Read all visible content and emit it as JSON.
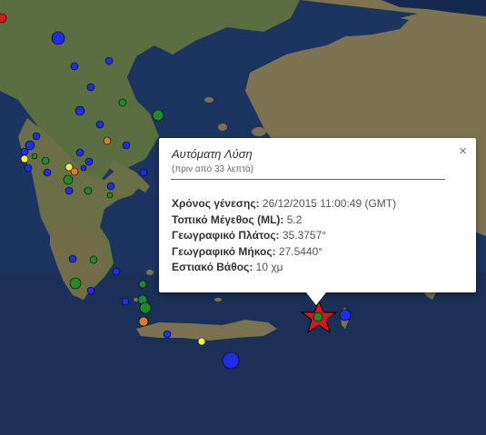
{
  "popup": {
    "title": "Αυτόματη Λύση",
    "subtitle": "(πριν από 33 λεπτά)",
    "close": "×",
    "rows": [
      {
        "label": "Χρόνος γένεσης:",
        "value": " 26/12/2015  11:00:49 (GMT)"
      },
      {
        "label": "Τοπικό Μέγεθος (ML):",
        "value": " 5.2"
      },
      {
        "label": "Γεωγραφικό Πλάτος:",
        "value": " 35.3757°"
      },
      {
        "label": "Γεωγραφικό Μήκος:",
        "value": " 27.5440°"
      },
      {
        "label": "Εστιακό Βάθος:",
        "value": " 10 χμ"
      }
    ]
  },
  "map": {
    "colors": {
      "sea_dark": "#10233f",
      "sea": "#1f3a66",
      "land_green": "#4d6b3a",
      "land_brown": "#7a7150",
      "land_light": "#9a8f6e",
      "quake_blue": "#1f2ee6",
      "quake_green": "#1f8a2a",
      "quake_orange": "#e07a2a",
      "quake_yellow": "#f2f23a",
      "quake_red": "#e01818",
      "epicenter_star": "#d81818"
    }
  }
}
